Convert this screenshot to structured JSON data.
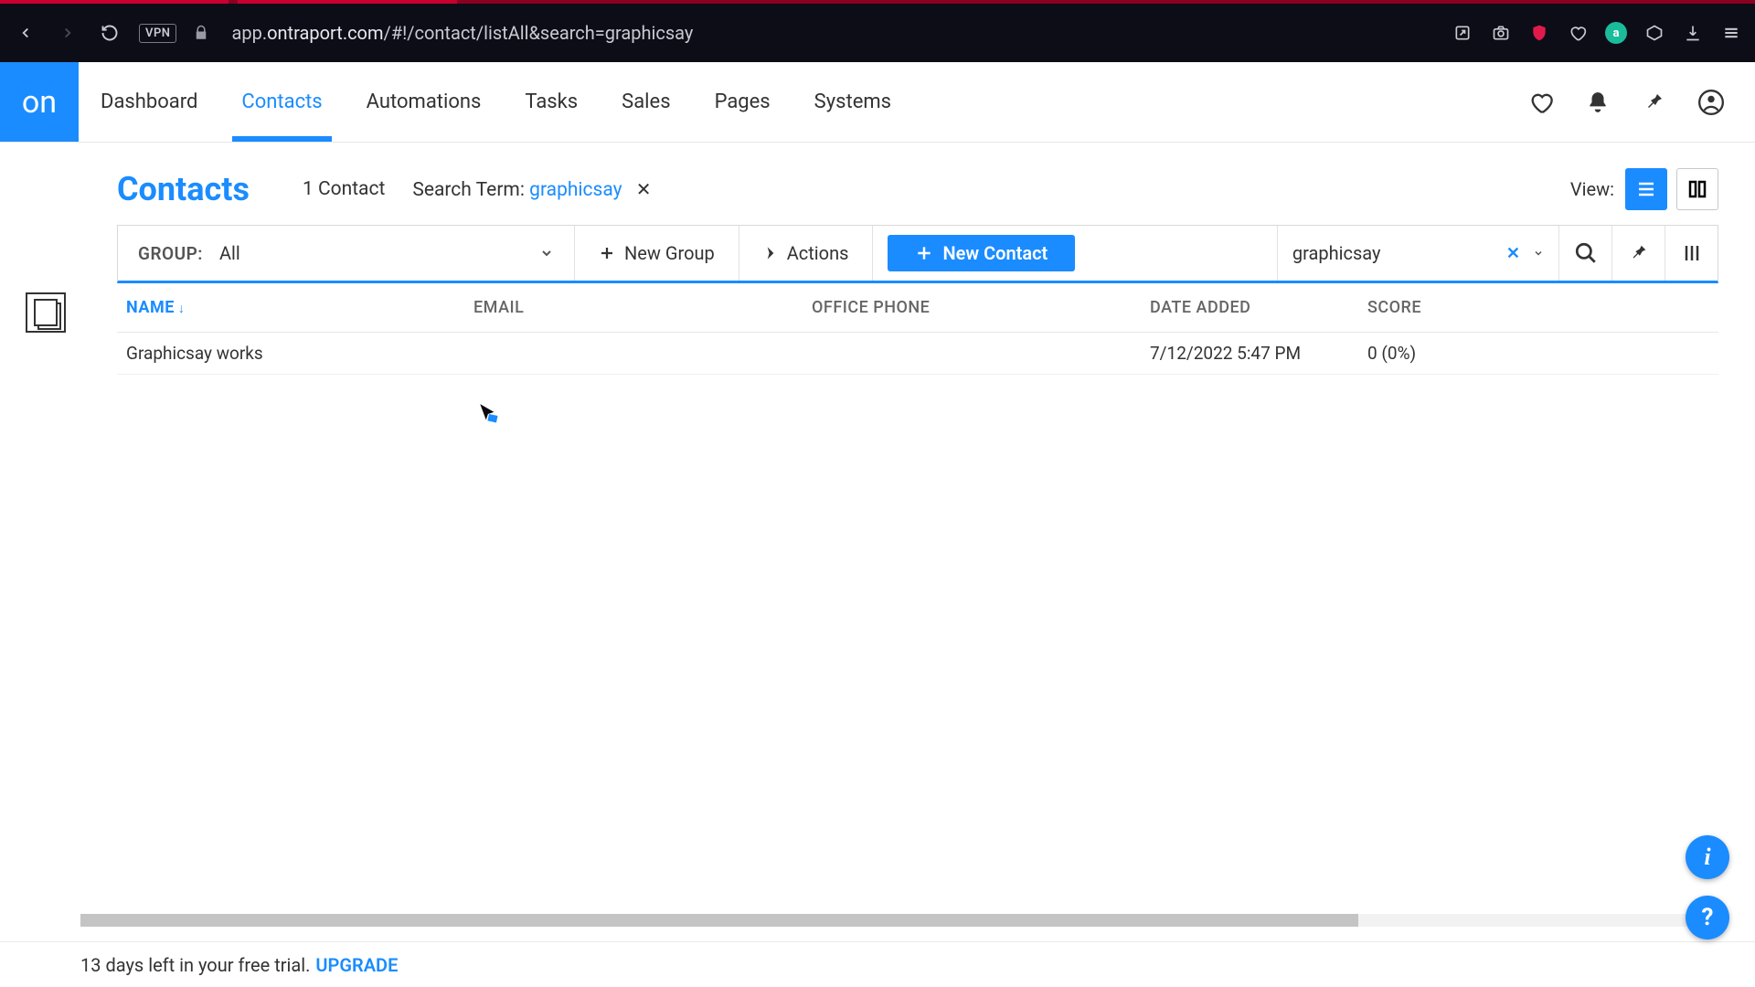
{
  "browser": {
    "url_plain": "app.",
    "url_domain": "ontraport.com",
    "url_rest": "/#!/contact/listAll&search=graphicsay",
    "vpn": "VPN",
    "avatar_letter": "a"
  },
  "nav": {
    "logo": "on",
    "items": [
      "Dashboard",
      "Contacts",
      "Automations",
      "Tasks",
      "Sales",
      "Pages",
      "Systems"
    ],
    "active_index": 1
  },
  "header": {
    "title": "Contacts",
    "count": "1 Contact",
    "search_label": "Search Term: ",
    "search_value": "graphicsay",
    "view_label": "View:"
  },
  "toolbar": {
    "group_label": "GROUP:",
    "group_value": "All",
    "new_group": "New Group",
    "actions": "Actions",
    "new_contact": "New Contact",
    "search_value": "graphicsay"
  },
  "table": {
    "columns": [
      "NAME",
      "EMAIL",
      "OFFICE PHONE",
      "DATE ADDED",
      "SCORE"
    ],
    "rows": [
      {
        "name": "Graphicsay works",
        "email": "",
        "phone": "",
        "date": "7/12/2022 5:47 PM",
        "score": "0 (0%)"
      }
    ]
  },
  "trial": {
    "text": "13 days left in your free trial. ",
    "upgrade": "UPGRADE"
  },
  "fab": {
    "info": "i",
    "help": "?"
  }
}
